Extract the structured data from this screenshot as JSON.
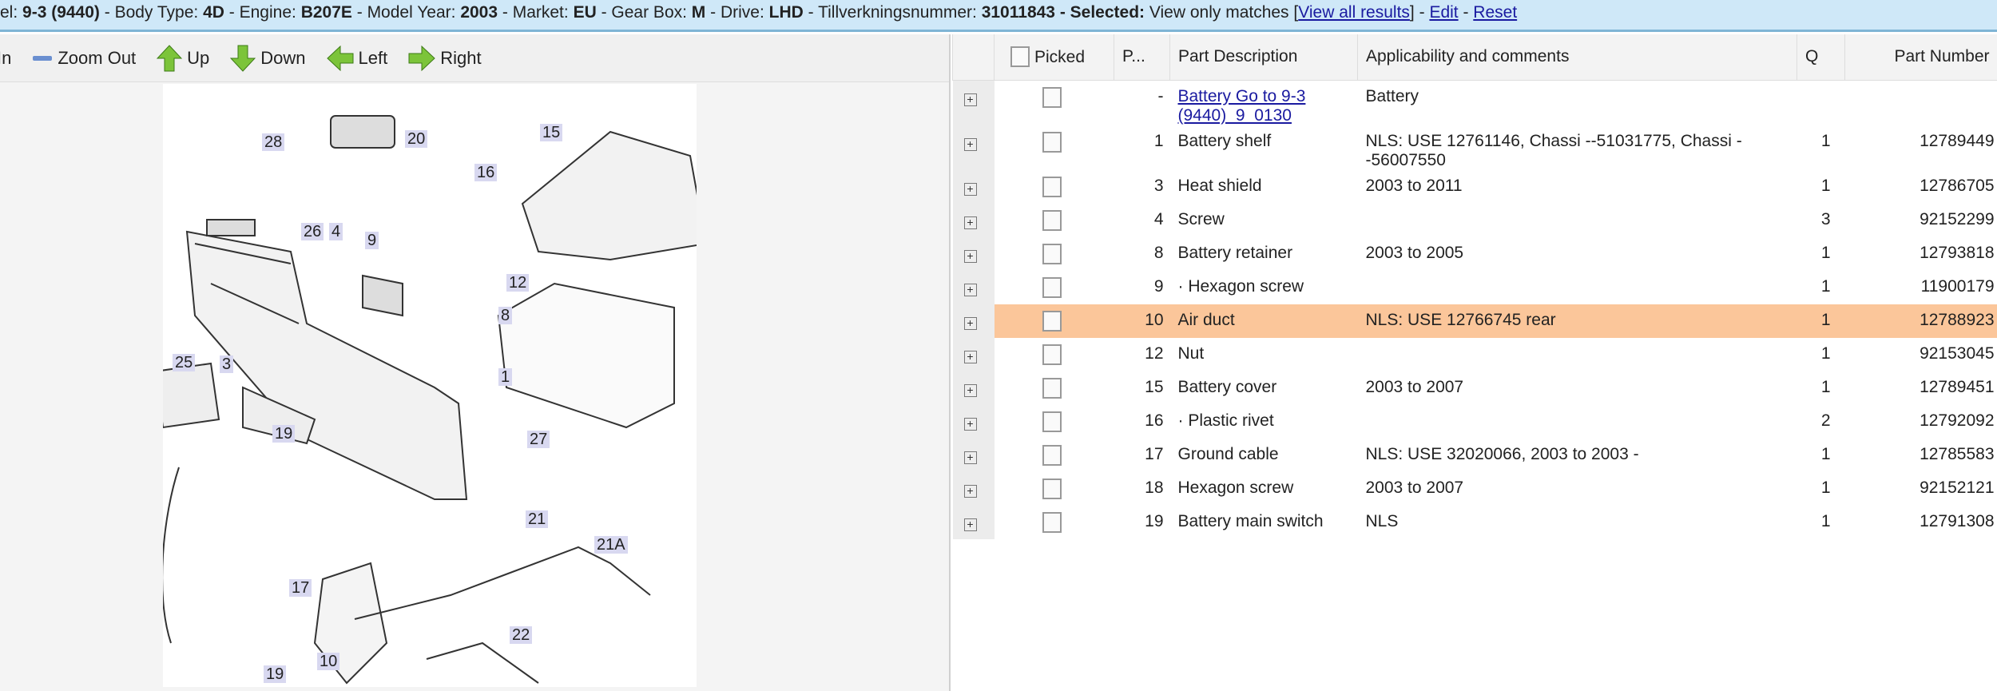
{
  "vehicle_bar": {
    "model_label": "el: ",
    "model": "9-3 (9440)",
    "body_label": " - Body Type: ",
    "body": "4D",
    "engine_label": " - Engine: ",
    "engine": "B207E",
    "year_label": " - Model Year: ",
    "year": "2003",
    "market_label": " - Market: ",
    "market": "EU",
    "gearbox_label": " - Gear Box: ",
    "gearbox": "M",
    "drive_label": " - Drive: ",
    "drive": "LHD",
    "serial_label": " - Tillverkningsnummer: ",
    "serial": "31011843",
    "selected_label": " - Selected:",
    "selected_value": " View only matches ",
    "view_all": "View all results",
    "sep1": " - ",
    "edit": "Edit",
    "sep2": " - ",
    "reset": "Reset"
  },
  "toolbar": {
    "zoom_in": "In",
    "zoom_out": "Zoom Out",
    "up": "Up",
    "down": "Down",
    "left": "Left",
    "right": "Right"
  },
  "diagram": {
    "callouts": [
      "28",
      "20",
      "15",
      "16",
      "26",
      "4",
      "9",
      "12",
      "8",
      "25",
      "3",
      "1",
      "27",
      "19",
      "21",
      "21A",
      "17",
      "22",
      "10",
      "19"
    ]
  },
  "table": {
    "headers": {
      "picked": "Picked",
      "pos": "P...",
      "desc": "Part Description",
      "applic": "Applicability and comments",
      "qty": "Q",
      "part_number": "Part Number"
    },
    "rows": [
      {
        "pos": "-",
        "desc": "Battery Go to 9-3 (9440)_9_0130",
        "applic": "Battery",
        "qty": "",
        "pn": "",
        "link": true
      },
      {
        "pos": "1",
        "desc": "Battery shelf",
        "applic": "NLS: USE 12761146, Chassi --51031775, Chassi --56007550",
        "qty": "1",
        "pn": "12789449"
      },
      {
        "pos": "3",
        "desc": "Heat shield",
        "applic": "2003 to 2011",
        "qty": "1",
        "pn": "12786705"
      },
      {
        "pos": "4",
        "desc": "Screw",
        "applic": "",
        "qty": "3",
        "pn": "92152299"
      },
      {
        "pos": "8",
        "desc": "Battery retainer",
        "applic": "2003 to 2005",
        "qty": "1",
        "pn": "12793818"
      },
      {
        "pos": "9",
        "desc": "· Hexagon screw",
        "applic": "",
        "qty": "1",
        "pn": "11900179"
      },
      {
        "pos": "10",
        "desc": "Air duct",
        "applic": "NLS: USE 12766745 rear",
        "qty": "1",
        "pn": "12788923",
        "highlight": true
      },
      {
        "pos": "12",
        "desc": "Nut",
        "applic": "",
        "qty": "1",
        "pn": "92153045"
      },
      {
        "pos": "15",
        "desc": "Battery cover",
        "applic": "2003 to 2007",
        "qty": "1",
        "pn": "12789451"
      },
      {
        "pos": "16",
        "desc": "· Plastic rivet",
        "applic": "",
        "qty": "2",
        "pn": "12792092"
      },
      {
        "pos": "17",
        "desc": "Ground cable",
        "applic": "NLS: USE 32020066, 2003 to 2003 -",
        "qty": "1",
        "pn": "12785583"
      },
      {
        "pos": "18",
        "desc": "Hexagon screw",
        "applic": "2003 to 2007",
        "qty": "1",
        "pn": "92152121"
      },
      {
        "pos": "19",
        "desc": "Battery main switch",
        "applic": "NLS",
        "qty": "1",
        "pn": "12791308"
      }
    ]
  },
  "colors": {
    "highlight": "#fbc69a",
    "topbar": "#cfe8f8",
    "link": "#1a1aa0"
  }
}
